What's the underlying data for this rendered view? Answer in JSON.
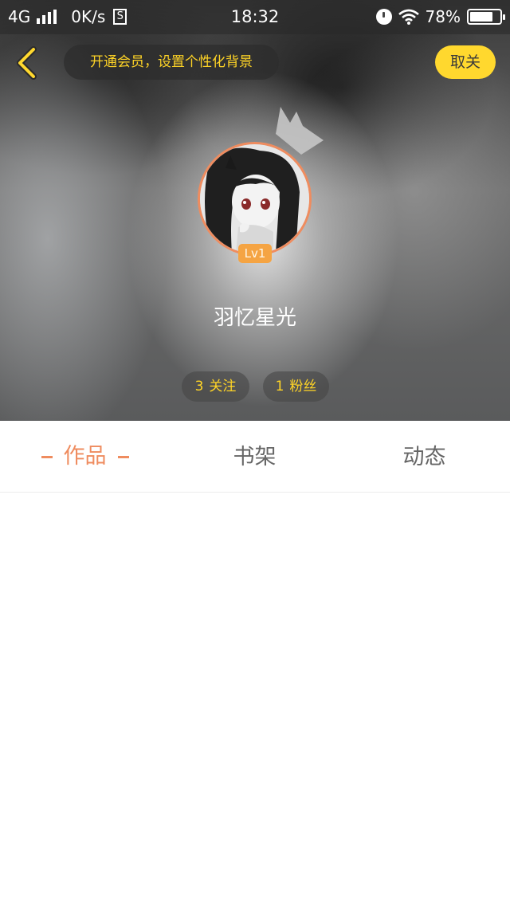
{
  "status_bar": {
    "network": "4G",
    "speed": "0K/s",
    "s_icon_label": "S",
    "time": "18:32",
    "battery_percent": "78%",
    "battery_level": 0.78,
    "icons": [
      "signal-icon",
      "alarm-icon",
      "wifi-icon",
      "battery-icon"
    ]
  },
  "header": {
    "back_icon": "chevron-left-icon",
    "vip_banner": "开通会员，设置个性化背景",
    "unfollow_label": "取关"
  },
  "profile": {
    "crown_icon": "crown-icon",
    "level": "Lv1",
    "username": "羽忆星光",
    "following_count": "3",
    "following_label": "关注",
    "fans_count": "1",
    "fans_label": "粉丝"
  },
  "tabs": [
    {
      "label": "作品",
      "active": true
    },
    {
      "label": "书架",
      "active": false
    },
    {
      "label": "动态",
      "active": false
    }
  ],
  "colors": {
    "accent_orange": "#ef8c5f",
    "vip_yellow": "#ffd426",
    "button_yellow": "#ffd82e",
    "level_badge": "#f5a443"
  }
}
